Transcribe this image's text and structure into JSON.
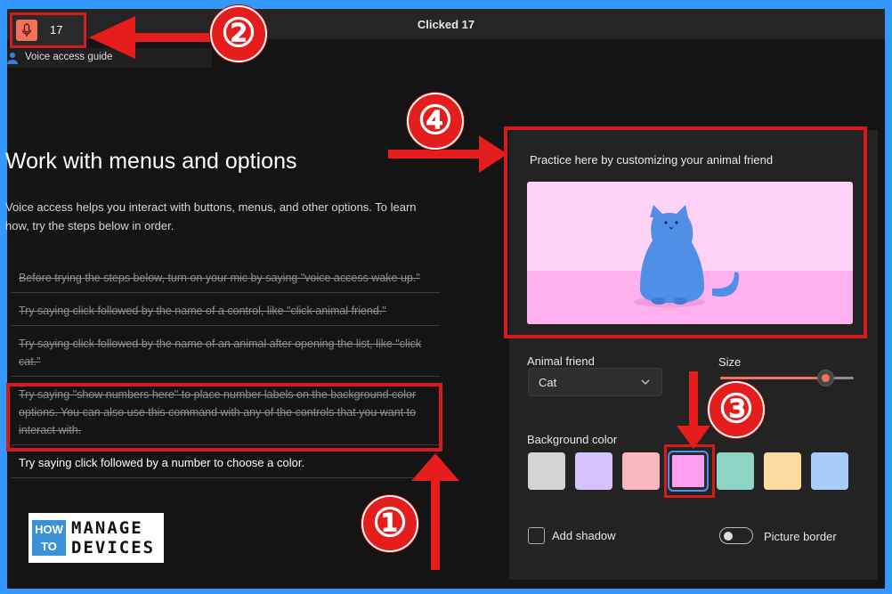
{
  "topbar": {
    "title": "Clicked 17",
    "mic_count": "17",
    "guide_label": "Voice access guide"
  },
  "lesson": {
    "heading": "Work with menus and options",
    "intro": "Voice access helps you interact with buttons, menus, and other options. To learn how, try the steps below in order.",
    "steps": [
      {
        "text": "Before trying the steps below, turn on your mic by saying \"voice access wake up.\"",
        "done": true
      },
      {
        "text": "Try saying click followed by the name of a control, like \"click animal friend.\"",
        "done": true
      },
      {
        "text": "Try saying click followed by the name of an animal after opening the list, like \"click cat.\"",
        "done": true
      },
      {
        "text": "Try saying \"show numbers here\" to place number labels on the background color options. You can also use this command with any of the controls that you want to interact with.",
        "done": true
      },
      {
        "text": "Try saying click followed by a number to choose a color.",
        "done": false
      }
    ]
  },
  "practice": {
    "title": "Practice here by customizing your animal friend",
    "animal_label": "Animal friend",
    "animal_value": "Cat",
    "size_label": "Size",
    "size_level": 0.79,
    "background_label": "Background color",
    "swatches": [
      "#d4d4d4",
      "#d5c4fb",
      "#f9b8be",
      "#ff9ff3",
      "#8dd6c5",
      "#fcdba1",
      "#a9ccfa"
    ],
    "selected_swatch": 3,
    "add_shadow_label": "Add shadow",
    "picture_border_label": "Picture border"
  },
  "logo": {
    "how": "HOW",
    "to": "TO",
    "manage": "MANAGE",
    "devices": "DEVICES"
  },
  "annotations": [
    "①",
    "②",
    "③",
    "④"
  ],
  "colors": {
    "annotation_red": "#e51d1d",
    "accent_orange": "#f2735a",
    "frame_blue": "#3399ff",
    "cat_blue": "#4f8fe6"
  },
  "icons": {
    "mic": "microphone-icon",
    "guide": "person-icon",
    "dropdown": "chevron-down-icon"
  }
}
